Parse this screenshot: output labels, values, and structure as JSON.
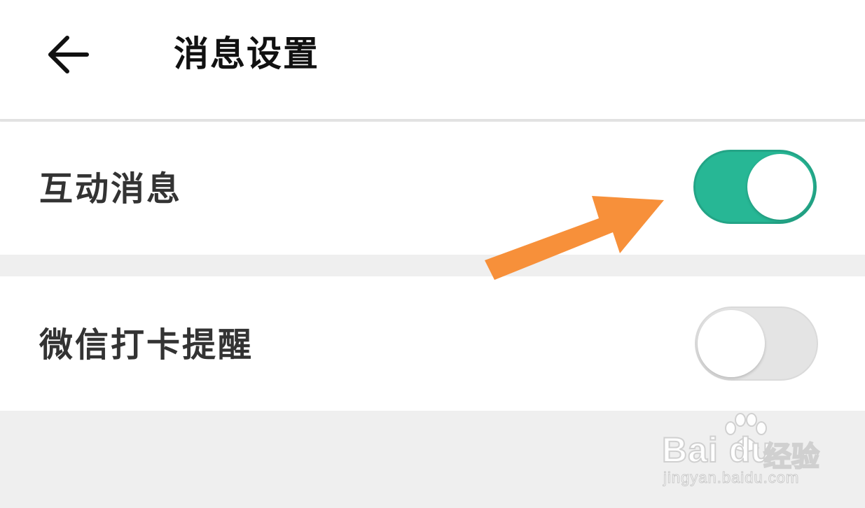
{
  "header": {
    "title": "消息设置",
    "back_icon": "arrow-left-icon"
  },
  "settings": [
    {
      "label": "互动消息",
      "enabled": true,
      "toggle_color": "#27b795"
    },
    {
      "label": "微信打卡提醒",
      "enabled": false,
      "toggle_color": "#e4e4e4"
    }
  ],
  "annotation": {
    "icon": "arrow-pointer-icon",
    "color": "#f7903a"
  },
  "watermark": {
    "brand": "Bai du",
    "suffix": "经验",
    "url": "jingyan.baidu.com"
  }
}
